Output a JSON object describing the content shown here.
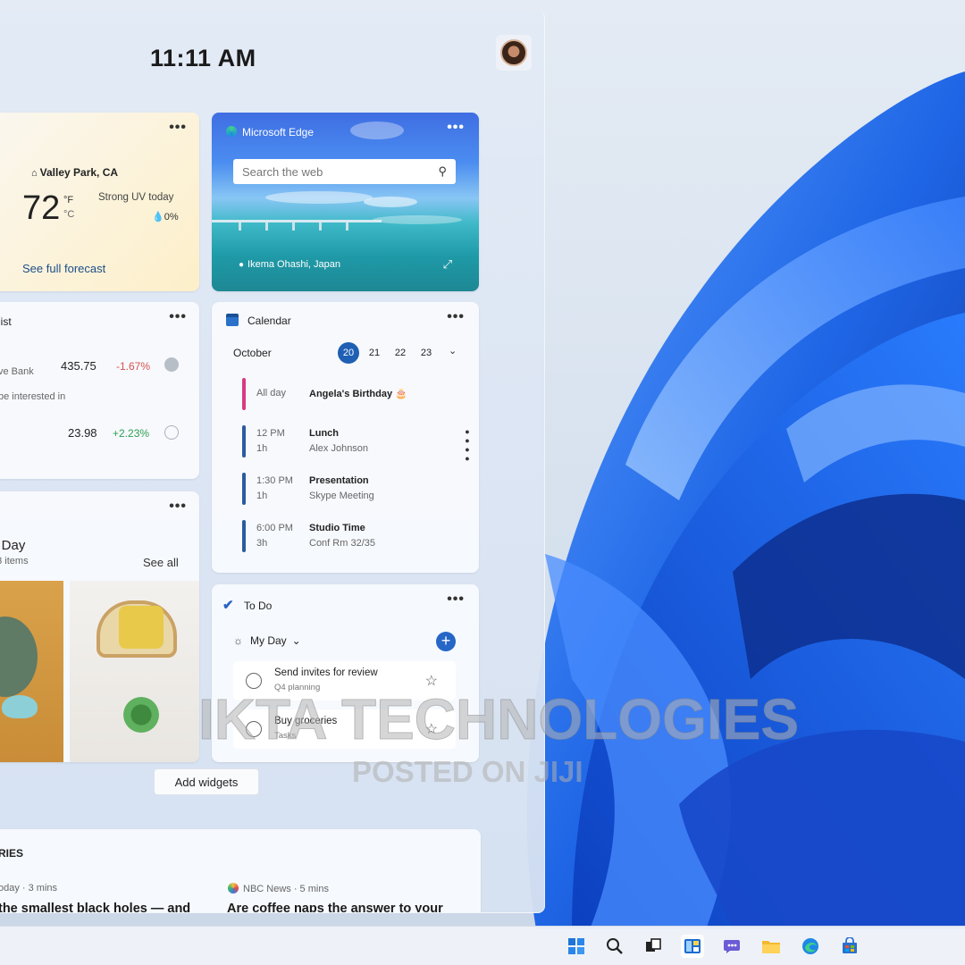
{
  "clock": "11:11 AM",
  "weather": {
    "location": "Valley Park, CA",
    "temp": "72",
    "unit_f": "°F",
    "unit_c": "°C",
    "condition": "Strong UV today",
    "precip": "0%",
    "link": "See full forecast",
    "more": "•••"
  },
  "edge": {
    "brand": "Microsoft Edge",
    "search_placeholder": "Search the web",
    "place": "Ikema Ohashi, Japan",
    "more": "•••"
  },
  "watchlist": {
    "title": "list",
    "more": "•••",
    "rows": [
      {
        "name": "ve Bank",
        "value": "435.75",
        "change": "-1.67%"
      },
      {
        "name": "",
        "value": "23.98",
        "change": "+2.23%"
      }
    ],
    "sub": "be interested in"
  },
  "calendar": {
    "title": "Calendar",
    "more": "•••",
    "month": "October",
    "days": [
      "20",
      "21",
      "22",
      "23"
    ],
    "events": [
      {
        "time": "All day",
        "duration": "",
        "name": "Angela's Birthday 🎂",
        "detail": "",
        "color": "#d63b82"
      },
      {
        "time": "12 PM",
        "duration": "1h",
        "name": "Lunch",
        "detail": "Alex Johnson",
        "color": "#2c5aa0"
      },
      {
        "time": "1:30 PM",
        "duration": "1h",
        "name": "Presentation",
        "detail": "Skype Meeting",
        "color": "#2c5aa0"
      },
      {
        "time": "6:00 PM",
        "duration": "3h",
        "name": "Studio Time",
        "detail": "Conf Rm 32/35",
        "color": "#2c5aa0"
      }
    ]
  },
  "photos": {
    "title": "s Day",
    "subtitle": "13 items",
    "see_all": "See all",
    "more": "•••"
  },
  "todo": {
    "title": "To Do",
    "more": "•••",
    "list": "My Day",
    "tasks": [
      {
        "title": "Send invites for review",
        "sub": "Q4 planning"
      },
      {
        "title": "Buy groceries",
        "sub": "Tasks"
      }
    ]
  },
  "add_widgets": "Add widgets",
  "stories": {
    "head": "RIES",
    "items": [
      {
        "source": "oday · 3 mins",
        "headline": "the smallest black holes — and"
      },
      {
        "source": "NBC News · 5 mins",
        "headline": "Are coffee naps the answer to your"
      }
    ]
  },
  "watermark": {
    "line1": "IKTA TECHNOLOGIES",
    "line2": "POSTED ON JIJI"
  },
  "colors": {
    "accent": "#1f5fb4",
    "negative": "#d9534f",
    "positive": "#2e9e4f"
  }
}
